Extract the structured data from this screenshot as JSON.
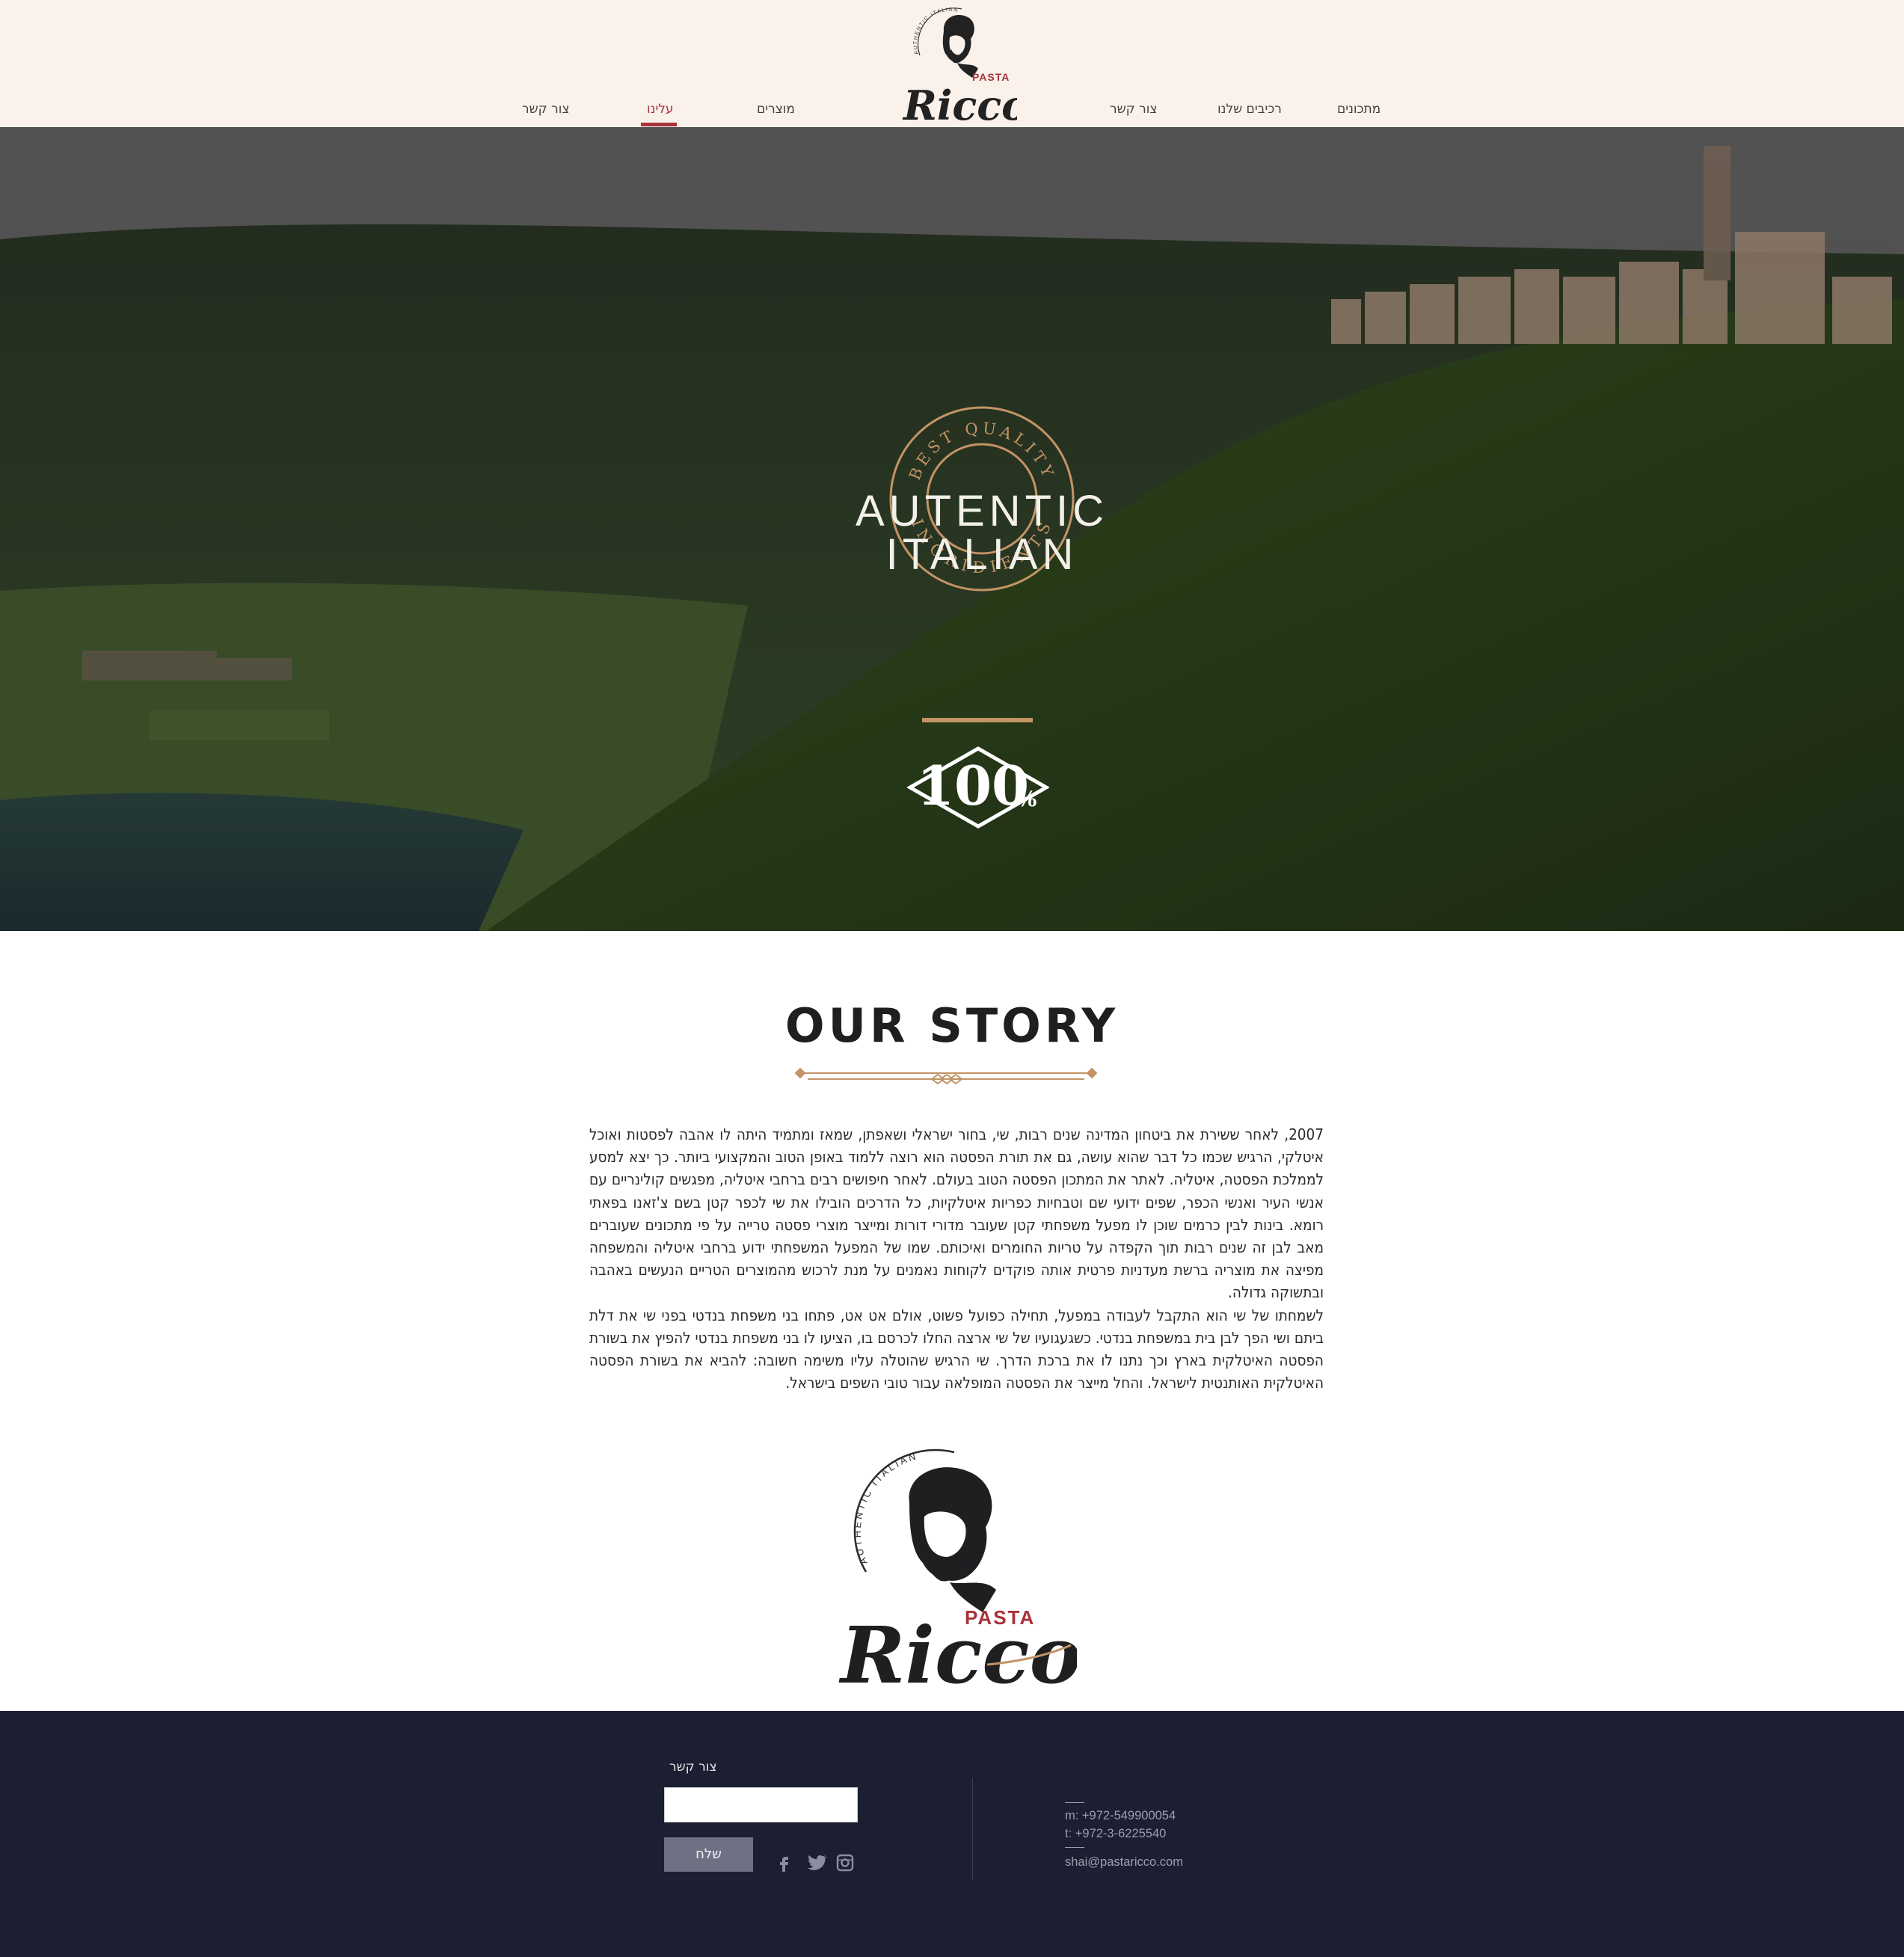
{
  "nav": {
    "left": [
      "צור קשר",
      "עלינו",
      "מוצרים"
    ],
    "right": [
      "צור קשר",
      "רכיבים שלנו",
      "מתכונים"
    ],
    "active": "עלינו"
  },
  "logo": {
    "arc_text": "AUTHENTIC ITALIAN",
    "pasta": "PASTA",
    "name": "Ricco"
  },
  "hero": {
    "badge_top": "BEST QUALITY",
    "badge_bottom": "INGRIDIENTS",
    "title_line1": "AUTENTIC",
    "title_line2": "ITALIAN",
    "hundred": "100",
    "percent": "%"
  },
  "story": {
    "title": "OUR STORY",
    "paragraph1": "2007, לאחר ששירת את ביטחון המדינה שנים רבות,  שי, בחור ישראלי ושאפתן, שמאז ומתמיד היתה לו אהבה לפסטות ואוכל איטלקי, הרגיש שכמו כל דבר שהוא עושה, גם את תורת הפסטה הוא רוצה ללמוד באופן הטוב והמקצועי ביותר. כך יצא למסע לממלכת הפסטה, איטליה. לאתר את המתכון הפסטה הטוב בעולם. לאחר חיפושים רבים ברחבי איטליה, מפגשים קולינריים עם אנשי העיר ואנשי הכפר, שפים ידועי שם וטבחיות כפריות איטלקיות, כל הדרכים הובילו את שי לכפר קטן בשם צ'זאנו בפאתי רומא. בינות לבין כרמים שוכן לו מפעל משפחתי קטן שעובר מדורי דורות ומייצר מוצרי פסטה טרייה על פי מתכונים שעוברים מאב לבן זה שנים רבות תוך הקפדה על טריות החומרים ואיכותם. שמו של המפעל המשפחתי ידוע ברחבי איטליה והמשפחה מפיצה את מוצריה ברשת מעדניות פרטית אותה פוקדים לקוחות נאמנים על מנת לרכוש מהמוצרים הטריים הנעשים באהבה ובתשוקה גדולה.",
    "paragraph2": "לשמחתו של שי הוא התקבל לעבודה במפעל, תחילה כפועל פשוט, אולם אט אט, פתחו בני משפחת בנדטי בפני שי את דלת ביתם ושי הפך לבן בית במשפחת בנדטי. כשגעגועיו של שי ארצה החלו לכרסם בו, הציעו לו בני משפחת בנדטי להפיץ את בשורת הפסטה האיטלקית בארץ וכך נתנו לו את ברכת הדרך. שי הרגיש שהוטלה עליו משימה חשובה: להביא את בשורת הפסטה האיטלקית האותנטית לישראל. והחל מייצר את הפסטה המופלאה עבור טובי השפים בישראל."
  },
  "footer": {
    "contact_label": "צור קשר",
    "input_value": "",
    "send_label": "שלח",
    "phone_mobile": "m: +972-549900054",
    "phone_tel": "t:  +972-3-6225540",
    "email": "shai@pastaricco.com"
  },
  "colors": {
    "header_bg": "#f9f1ea",
    "accent_red": "#a8323a",
    "gold": "#c39466",
    "footer_bg": "#1c1f31"
  }
}
